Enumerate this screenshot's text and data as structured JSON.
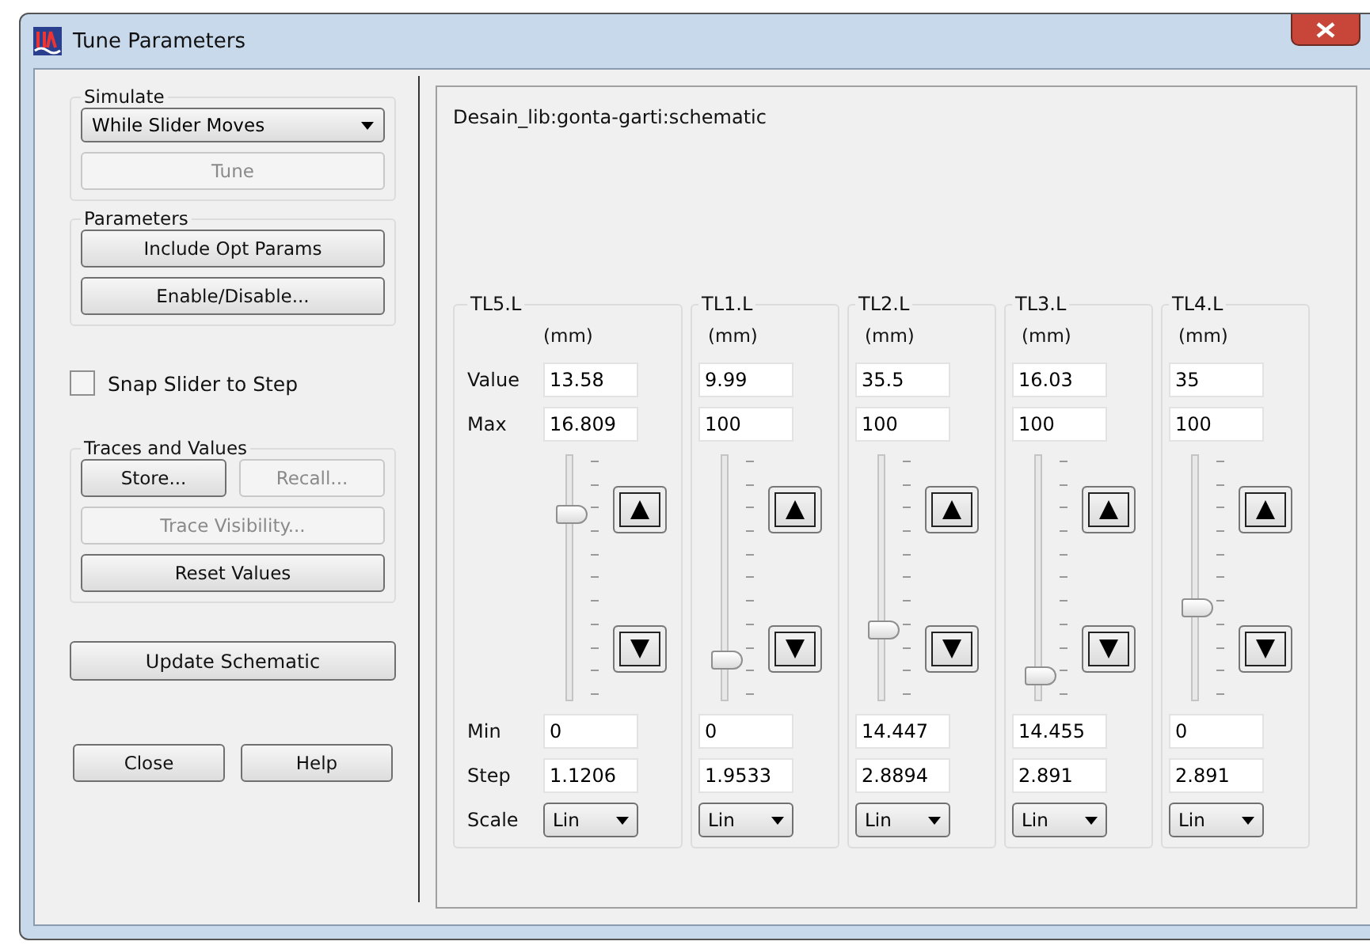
{
  "window": {
    "title": "Tune Parameters"
  },
  "simulate": {
    "label": "Simulate",
    "mode": "While Slider Moves",
    "tune": {
      "label": "Tune",
      "disabled": true
    }
  },
  "parameters_group": {
    "label": "Parameters",
    "buttons": [
      {
        "label": "Include Opt Params",
        "disabled": false
      },
      {
        "label": "Enable/Disable...",
        "disabled": false
      }
    ]
  },
  "snap": {
    "label": "Snap Slider to Step",
    "checked": false
  },
  "traces": {
    "label": "Traces and Values",
    "store": {
      "label": "Store...",
      "disabled": false
    },
    "recall": {
      "label": "Recall...",
      "disabled": true
    },
    "visibility": {
      "label": "Trace Visibility...",
      "disabled": true
    },
    "reset": {
      "label": "Reset Values",
      "disabled": false
    }
  },
  "update_button": "Update Schematic",
  "close_button": "Close",
  "help_button": "Help",
  "design": "Desain_lib:gonta-garti:schematic",
  "row_labels": {
    "value": "Value",
    "max": "Max",
    "min": "Min",
    "step": "Step",
    "scale": "Scale"
  },
  "params": [
    {
      "name": "TL5.L",
      "unit": "(mm)",
      "value": "13.58",
      "max": "16.809",
      "level": 0.8,
      "min": "0",
      "step": "1.1206",
      "scale": "Lin"
    },
    {
      "name": "TL1.L",
      "unit": "(mm)",
      "value": "9.99",
      "max": "100",
      "level": 0.14,
      "min": "0",
      "step": "1.9533",
      "scale": "Lin"
    },
    {
      "name": "TL2.L",
      "unit": "(mm)",
      "value": "35.5",
      "max": "100",
      "level": 0.28,
      "min": "14.447",
      "step": "2.8894",
      "scale": "Lin"
    },
    {
      "name": "TL3.L",
      "unit": "(mm)",
      "value": "16.03",
      "max": "100",
      "level": 0.07,
      "min": "14.455",
      "step": "2.891",
      "scale": "Lin"
    },
    {
      "name": "TL4.L",
      "unit": "(mm)",
      "value": "35",
      "max": "100",
      "level": 0.38,
      "min": "0",
      "step": "2.891",
      "scale": "Lin"
    }
  ]
}
